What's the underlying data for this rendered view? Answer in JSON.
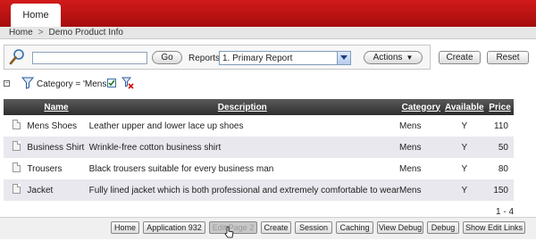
{
  "tabs": [
    {
      "label": "Home"
    }
  ],
  "breadcrumb": {
    "items": [
      "Home",
      "Demo Product Info"
    ],
    "separator": ">"
  },
  "search": {
    "placeholder": "",
    "value": "",
    "go_label": "Go",
    "reports_label": "Reports",
    "report_selected": "1. Primary Report",
    "actions_label": "Actions"
  },
  "buttons": {
    "create_label": "Create",
    "reset_label": "Reset"
  },
  "filter": {
    "text": "Category = 'Mens'",
    "enabled": true
  },
  "table": {
    "columns": [
      "Name",
      "Description",
      "Category",
      "Available",
      "Price"
    ],
    "rows": [
      {
        "name": "Mens Shoes",
        "description": "Leather upper and lower lace up shoes",
        "category": "Mens",
        "available": "Y",
        "price": "110"
      },
      {
        "name": "Business Shirt",
        "description": "Wrinkle-free cotton business shirt",
        "category": "Mens",
        "available": "Y",
        "price": "50"
      },
      {
        "name": "Trousers",
        "description": "Black trousers suitable for every business man",
        "category": "Mens",
        "available": "Y",
        "price": "80"
      },
      {
        "name": "Jacket",
        "description": "Fully lined jacket which is both professional and extremely comfortable to wear",
        "category": "Mens",
        "available": "Y",
        "price": "150"
      }
    ]
  },
  "pagination": {
    "text": "1 - 4"
  },
  "dev_toolbar": {
    "items": [
      "Home",
      "Application 932",
      "Edit Page 2",
      "Create",
      "Session",
      "Caching",
      "View Debug",
      "Debug",
      "Show Edit Links"
    ]
  },
  "colors": {
    "brand_red": "#b40f0f",
    "header_dark": "#3a3a3a",
    "row_alt": "#e8e8ee"
  },
  "icons": [
    "search-icon",
    "funnel-icon",
    "remove-filter-icon",
    "document-icon",
    "chevron-down-icon",
    "mouse-pointer-icon"
  ]
}
